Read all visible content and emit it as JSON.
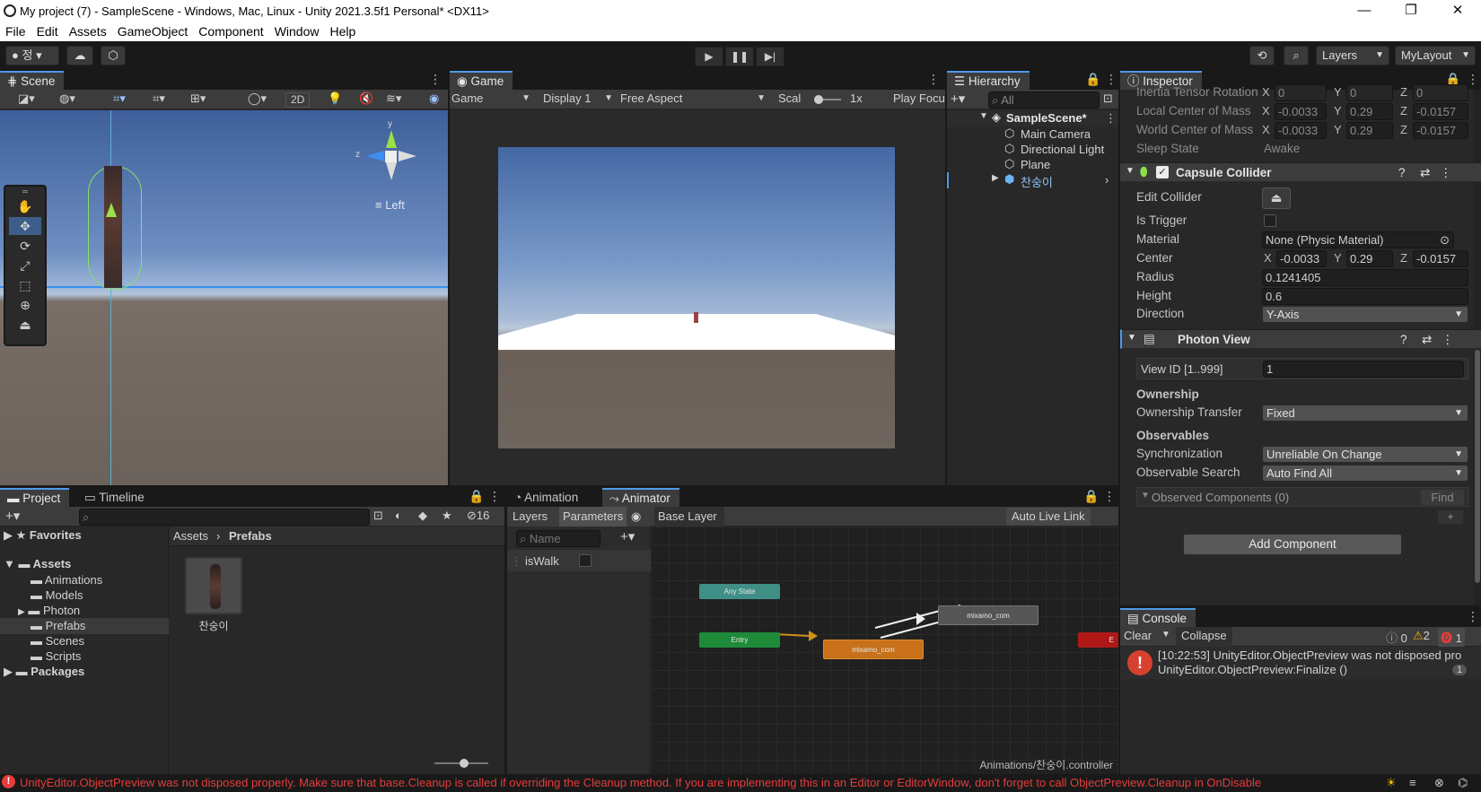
{
  "window": {
    "title": "My project (7) - SampleScene - Windows, Mac, Linux - Unity 2021.3.5f1 Personal* <DX11>",
    "minimize": "—",
    "maximize": "❐",
    "close": "✕"
  },
  "menu": [
    "File",
    "Edit",
    "Assets",
    "GameObject",
    "Component",
    "Window",
    "Help"
  ],
  "toolbar": {
    "account": "정",
    "layers": "Layers",
    "layout": "MyLayout"
  },
  "scene": {
    "tab": "Scene",
    "btn_2d": "2D",
    "orientation": "Left",
    "gizmo_y": "y",
    "gizmo_z": "z"
  },
  "game": {
    "tab": "Game",
    "mode": "Game",
    "display": "Display 1",
    "aspect": "Free Aspect",
    "scale_label": "Scal",
    "scale_value": "1x",
    "play_focus": "Play Focu"
  },
  "hierarchy": {
    "tab": "Hierarchy",
    "search_placeholder": "All",
    "scene": "SampleScene*",
    "items": [
      "Main Camera",
      "Directional Light",
      "Plane",
      "찬숭이"
    ]
  },
  "inspector": {
    "tab": "Inspector",
    "rigid_rows": [
      {
        "label": "Inertia Tensor Rotation",
        "x": "0",
        "y": "0",
        "z": "0"
      },
      {
        "label": "Local Center of Mass",
        "x": "-0.0033",
        "y": "0.29",
        "z": "-0.0157"
      },
      {
        "label": "World Center of Mass",
        "x": "-0.0033",
        "y": "0.29",
        "z": "-0.0157"
      }
    ],
    "sleep_label": "Sleep State",
    "sleep_value": "Awake",
    "capsule": {
      "title": "Capsule Collider",
      "edit_label": "Edit Collider",
      "trigger_label": "Is Trigger",
      "material_label": "Material",
      "material_value": "None (Physic Material)",
      "center_label": "Center",
      "cx": "-0.0033",
      "cy": "0.29",
      "cz": "-0.0157",
      "radius_label": "Radius",
      "radius_value": "0.1241405",
      "height_label": "Height",
      "height_value": "0.6",
      "direction_label": "Direction",
      "direction_value": "Y-Axis"
    },
    "photon": {
      "title": "Photon View",
      "viewid_label": "View ID [1..999]",
      "viewid_value": "1",
      "ownership_header": "Ownership",
      "transfer_label": "Ownership Transfer",
      "transfer_value": "Fixed",
      "observables_header": "Observables",
      "sync_label": "Synchronization",
      "sync_value": "Unreliable On Change",
      "search_label": "Observable Search",
      "search_value": "Auto Find All",
      "observed_label": "Observed Components (0)",
      "find_label": "Find"
    },
    "add_component": "Add Component"
  },
  "project": {
    "tab": "Project",
    "timeline_tab": "Timeline",
    "hidden_count": "16",
    "favorites": "Favorites",
    "assets": "Assets",
    "folders": [
      "Animations",
      "Models",
      "Photon",
      "Prefabs",
      "Scenes",
      "Scripts"
    ],
    "packages": "Packages",
    "breadcrumb_root": "Assets",
    "breadcrumb_current": "Prefabs",
    "asset_name": "찬숭이"
  },
  "animator": {
    "anim_tab": "Animation",
    "animator_tab": "Animator",
    "layers_tab": "Layers",
    "params_tab": "Parameters",
    "base_layer": "Base Layer",
    "auto_live": "Auto Live Link",
    "name_placeholder": "Name",
    "param": "isWalk",
    "nodes": {
      "any": "Any State",
      "entry": "Entry",
      "mixamo1": "mixamo_com",
      "mixamo2": "mixamo_com",
      "exit": "E"
    },
    "footer": "Animations/찬숭이.controller"
  },
  "console": {
    "tab": "Console",
    "clear": "Clear",
    "collapse": "Collapse",
    "info_count": "0",
    "warn_count": "2",
    "error_count": "1",
    "message_line1": "[10:22:53] UnityEditor.ObjectPreview was not disposed pro",
    "message_line2": "UnityEditor.ObjectPreview:Finalize ()",
    "message_count": "1"
  },
  "status": {
    "message": "UnityEditor.ObjectPreview was not disposed properly. Make sure that base.Cleanup is called if overriding the Cleanup method. If you are implementing this in an Editor or EditorWindow, don't forget to call ObjectPreview.Cleanup in OnDisable"
  },
  "colors": {
    "accent": "#4d9be8",
    "error": "#e63c3c",
    "warning": "#f0b000",
    "entry_node": "#1e8a3a",
    "any_state_node": "#3f8f86",
    "default_node": "#c8711a",
    "exit_node": "#b01818"
  }
}
